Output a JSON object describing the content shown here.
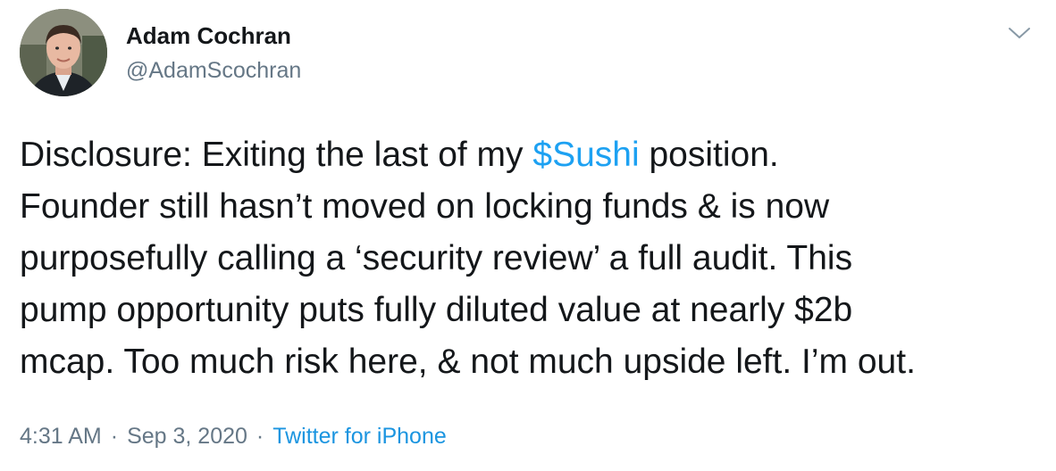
{
  "author": {
    "display_name": "Adam Cochran",
    "handle": "@AdamScochran"
  },
  "menu_icon": "chevron-down-icon",
  "tweet": {
    "lines": [
      {
        "before": "Disclosure: Exiting the last of my ",
        "cashtag": "$Sushi",
        "after": " position."
      },
      {
        "text": "Founder still hasn’t moved on locking funds & is now"
      },
      {
        "text": "purposefully calling a ‘security review’ a full audit. This"
      },
      {
        "text": "pump opportunity puts fully diluted value at nearly $2b"
      },
      {
        "text": "mcap. Too much risk here, & not much upside left. I’m out."
      }
    ]
  },
  "meta": {
    "time": "4:31 AM",
    "separator": "·",
    "date": "Sep 3, 2020",
    "source": "Twitter for iPhone"
  },
  "colors": {
    "link": "#1da1f2",
    "secondary_text": "#657786",
    "primary_text": "#14171a"
  }
}
